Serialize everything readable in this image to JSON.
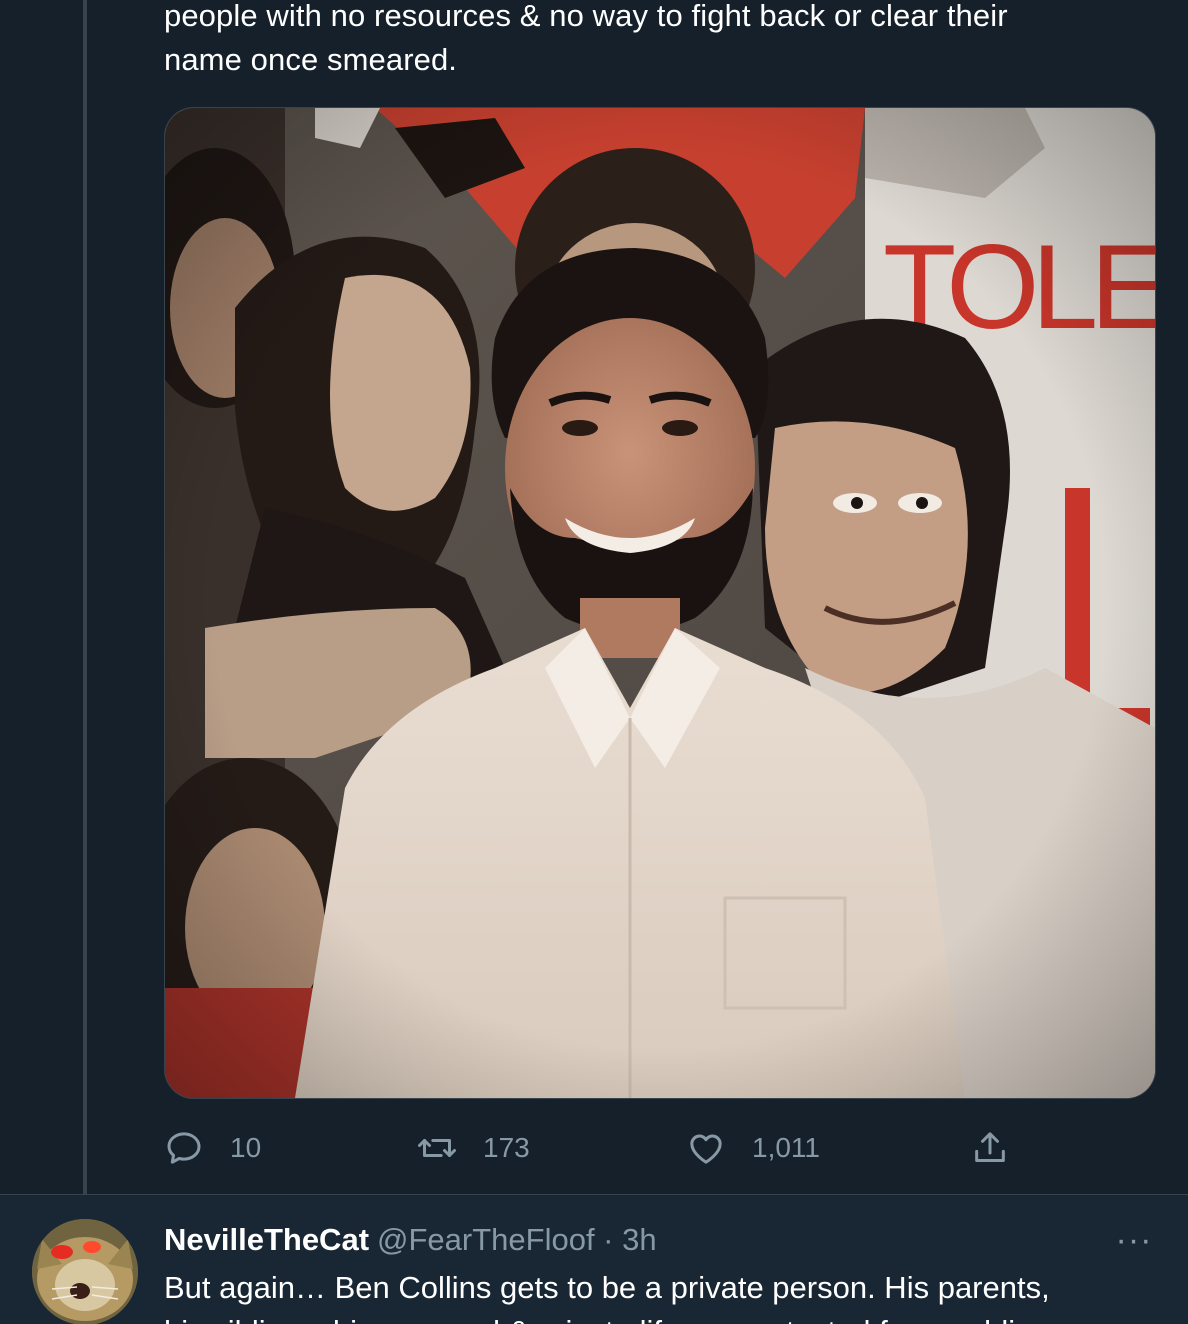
{
  "tweet": {
    "text_line1": "people with no resources & no way to fight back or clear their",
    "text_line2": "name once smeared.",
    "media": {
      "icon": "photo-image",
      "mural_text": "TOLE"
    },
    "actions": {
      "reply_count": "10",
      "retweet_count": "173",
      "like_count": "1,011"
    }
  },
  "reply": {
    "display_name": "NevilleTheCat",
    "meta": "@FearTheFloof · 3h",
    "more_label": "···",
    "text_line1": "But again… Ben Collins gets to be a private person. His parents,",
    "text_line2": "his siblings, his personal & private life are protected from public"
  },
  "colors": {
    "background": "#15202b",
    "reply_background": "#192734",
    "muted_text": "#8899a6",
    "border": "#38444d"
  }
}
